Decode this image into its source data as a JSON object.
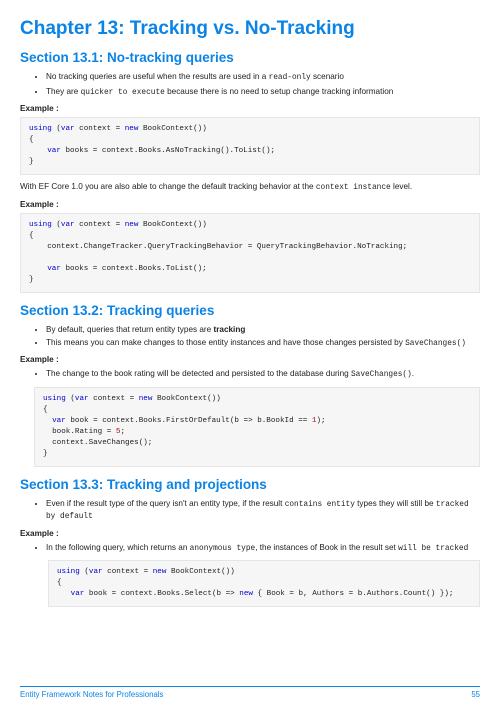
{
  "chapter_title": "Chapter 13: Tracking vs. No-Tracking",
  "s1": {
    "heading": "Section 13.1: No-tracking queries",
    "bullets": [
      {
        "pre": "No tracking queries are useful when the results are used in a ",
        "mono": "read-only",
        "post": " scenario"
      },
      {
        "pre": "They are ",
        "mono": "quicker to execute",
        "post": " because there is no need to setup change tracking information"
      }
    ],
    "example_label": "Example :",
    "code1": {
      "l1a": "using",
      "l1b": " (",
      "l1c": "var",
      "l1d": " context = ",
      "l1e": "new",
      "l1f": " BookContext())",
      "l2": "{",
      "l3a": "    ",
      "l3b": "var",
      "l3c": " books = context.Books.AsNoTracking().ToList();",
      "l4": "}"
    },
    "para_pre": "With EF Core 1.0 you are also able to change the default tracking behavior at the ",
    "para_mono": "context instance",
    "para_post": " level.",
    "code2": {
      "l1a": "using",
      "l1b": " (",
      "l1c": "var",
      "l1d": " context = ",
      "l1e": "new",
      "l1f": " BookContext())",
      "l2": "{",
      "l3": "    context.ChangeTracker.QueryTrackingBehavior = QueryTrackingBehavior.NoTracking;",
      "l4": "",
      "l5a": "    ",
      "l5b": "var",
      "l5c": " books = context.Books.ToList();",
      "l6": "}"
    }
  },
  "s2": {
    "heading": "Section 13.2: Tracking queries",
    "bullets": [
      {
        "pre": "By default, queries that return entity types are ",
        "bold": "tracking",
        "post": ""
      },
      {
        "pre": "This means you can make changes to those entity instances and have those changes persisted by ",
        "mono": "SaveChanges()",
        "post": ""
      }
    ],
    "example_label": "Example :",
    "ex_bullet_pre": "The change to the book rating will be detected and persisted to the database during ",
    "ex_bullet_mono": "SaveChanges()",
    "ex_bullet_post": ".",
    "code": {
      "l1a": "using",
      "l1b": " (",
      "l1c": "var",
      "l1d": " context = ",
      "l1e": "new",
      "l1f": " BookContext())",
      "l2": "{",
      "l3a": "  ",
      "l3b": "var",
      "l3c": " book = context.Books.FirstOrDefault(b => b.BookId == ",
      "l3d": "1",
      "l3e": ");",
      "l4a": "  book.Rating = ",
      "l4b": "5",
      "l4c": ";",
      "l5": "  context.SaveChanges();",
      "l6": "}"
    }
  },
  "s3": {
    "heading": "Section 13.3: Tracking and projections",
    "bullet_pre": "Even if the result type of the query isn't an entity type, if the result ",
    "bullet_mono1": "contains entity",
    "bullet_mid": " types they will still be ",
    "bullet_mono2": "tracked by default",
    "example_label": "Example :",
    "ex_bullet_pre": "In the following query, which returns an ",
    "ex_bullet_mono1": "anonymous type",
    "ex_bullet_mid": ", the instances of Book in the result set ",
    "ex_bullet_mono2": "will be tracked",
    "code": {
      "l1a": "using",
      "l1b": " (",
      "l1c": "var",
      "l1d": " context = ",
      "l1e": "new",
      "l1f": " BookContext())",
      "l2": "{",
      "l3a": "   ",
      "l3b": "var",
      "l3c": " book = context.Books.Select(b => ",
      "l3d": "new",
      "l3e": " { Book = b, Authors = b.Authors.Count() });"
    }
  },
  "footer": {
    "left": "Entity Framework Notes for Professionals",
    "right": "55"
  }
}
